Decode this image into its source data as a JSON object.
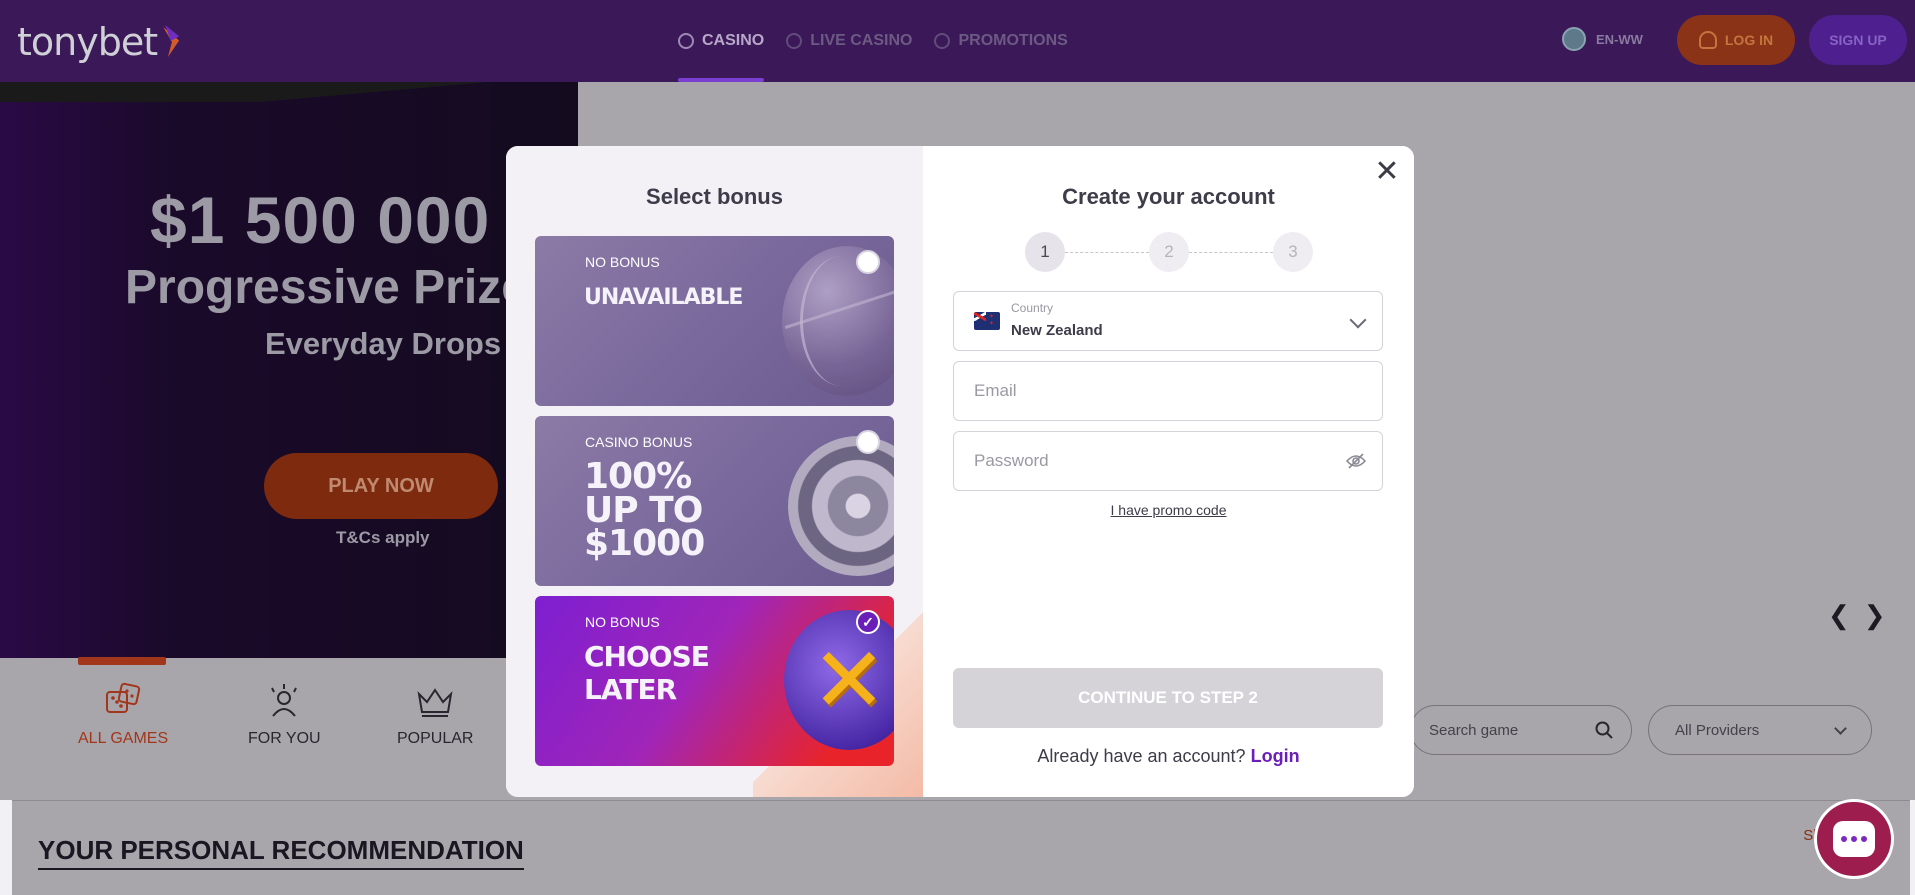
{
  "header": {
    "logo_text": "tonybet",
    "nav": [
      {
        "label": "CASINO",
        "icon": "casino-icon",
        "active": true
      },
      {
        "label": "LIVE CASINO",
        "icon": "live-casino-icon",
        "active": false
      },
      {
        "label": "PROMOTIONS",
        "icon": "promotions-icon",
        "active": false
      }
    ],
    "language": "EN-WW",
    "login_label": "LOG IN",
    "signup_label": "SIGN UP"
  },
  "hero": {
    "amount": "$1 500 000",
    "prize": "Progressive Prizes",
    "drops": "Everyday Drops",
    "play_label": "PLAY NOW",
    "tcs": "T&Cs apply"
  },
  "categories": [
    {
      "label": "ALL GAMES",
      "icon": "dice-icon",
      "active": true
    },
    {
      "label": "FOR YOU",
      "icon": "person-stars-icon",
      "active": false
    },
    {
      "label": "POPULAR",
      "icon": "crown-icon",
      "active": false
    }
  ],
  "search": {
    "placeholder": "Search game"
  },
  "providers": {
    "selected": "All Providers"
  },
  "recommendation": {
    "title": "YOUR PERSONAL RECOMMENDATION",
    "show_all": "Show all"
  },
  "modal": {
    "bonus_title": "Select bonus",
    "bonuses": [
      {
        "label": "NO BONUS",
        "title_lines": [
          "UNAVAILABLE"
        ],
        "selected": false,
        "deco": "basketball"
      },
      {
        "label": "CASINO BONUS",
        "title_lines": [
          "100%",
          "UP TO",
          "$1000"
        ],
        "selected": false,
        "deco": "roulette"
      },
      {
        "label": "NO BONUS",
        "title_lines": [
          "CHOOSE",
          "LATER"
        ],
        "selected": true,
        "deco": "x-mark"
      }
    ],
    "account_title": "Create your account",
    "steps": [
      "1",
      "2",
      "3"
    ],
    "current_step": 1,
    "country_label": "Country",
    "country_value": "New Zealand",
    "email_placeholder": "Email",
    "password_placeholder": "Password",
    "promo_link": "I have promo code",
    "continue_label": "CONTINUE TO STEP 2",
    "already_text": "Already have an account?",
    "login_link": "Login"
  },
  "colors": {
    "brand_purple": "#6a1fb8",
    "brand_orange": "#e2561e",
    "header_bg": "#3b1858"
  }
}
